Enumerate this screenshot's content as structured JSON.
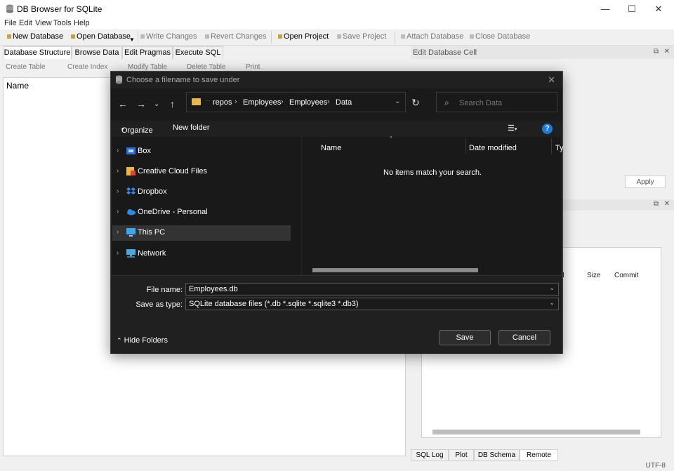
{
  "app": {
    "title": "DB Browser for SQLite",
    "menu": [
      "File",
      "Edit",
      "View",
      "Tools",
      "Help"
    ],
    "toolbar": {
      "new_db": "New Database",
      "open_db": "Open Database",
      "write_changes": "Write Changes",
      "revert_changes": "Revert Changes",
      "open_project": "Open Project",
      "save_project": "Save Project",
      "attach_db": "Attach Database",
      "close_db": "Close Database"
    },
    "tabs": [
      "Database Structure",
      "Browse Data",
      "Edit Pragmas",
      "Execute SQL"
    ],
    "structure_toolbar": {
      "create_table": "Create Table",
      "create_index": "Create Index",
      "modify_table": "Modify Table",
      "delete_table": "Delete Table",
      "print": "Print"
    },
    "tree_header": "Name",
    "edit_cell_title": "Edit Database Cell",
    "apply_label": "Apply",
    "remote_columns": [
      "d",
      "Size",
      "Commit"
    ],
    "bottom_tabs": [
      "SQL Log",
      "Plot",
      "DB Schema",
      "Remote"
    ],
    "encoding": "UTF-8"
  },
  "dialog": {
    "title": "Choose a filename to save under",
    "breadcrumb": [
      "repos",
      "Employees",
      "Employees",
      "Data"
    ],
    "search_placeholder": "Search Data",
    "organize_label": "Organize",
    "new_folder_label": "New folder",
    "nav_items": [
      {
        "label": "Box",
        "icon": "box-icon",
        "color": "#2f6fd6"
      },
      {
        "label": "Creative Cloud Files",
        "icon": "creative-cloud-icon",
        "color": "#d8462f"
      },
      {
        "label": "Dropbox",
        "icon": "dropbox-icon",
        "color": "#3a86f0"
      },
      {
        "label": "OneDrive - Personal",
        "icon": "onedrive-icon",
        "color": "#2b8ae6"
      },
      {
        "label": "This PC",
        "icon": "computer-icon",
        "color": "#3fa7e8"
      },
      {
        "label": "Network",
        "icon": "network-icon",
        "color": "#4aa7d8"
      }
    ],
    "columns": {
      "name": "Name",
      "date_modified": "Date modified",
      "type": "Ty"
    },
    "empty_message": "No items match your search.",
    "file_name_label": "File name:",
    "file_name_value": "Employees.db",
    "save_type_label": "Save as type:",
    "save_type_value": "SQLite database files (*.db *.sqlite *.sqlite3 *.db3)",
    "hide_folders_label": "Hide Folders",
    "save_label": "Save",
    "cancel_label": "Cancel"
  }
}
